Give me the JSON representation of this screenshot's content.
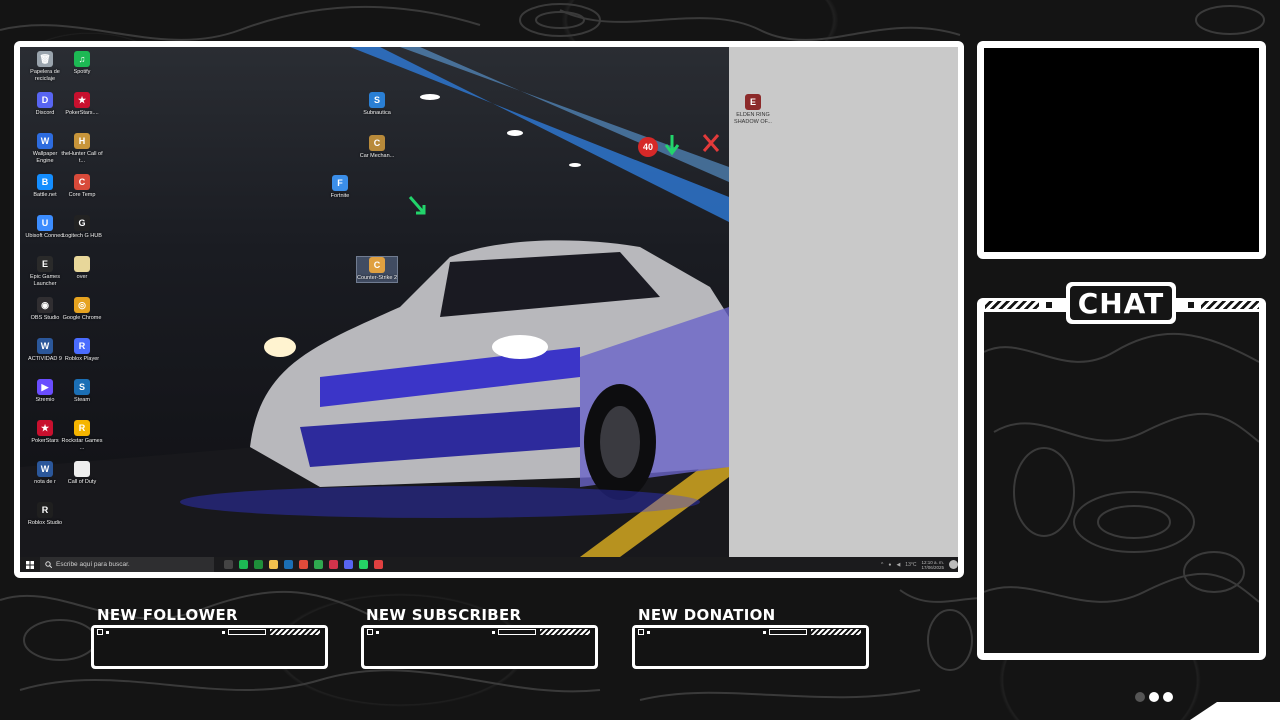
{
  "desktop": {
    "icons_left": [
      {
        "label": "Papelera de reciclaje",
        "color": "#9aa4ad",
        "glyph": "🗑"
      },
      {
        "label": "Spotify",
        "color": "#1db954",
        "glyph": "♫"
      },
      {
        "label": "Discord",
        "color": "#5865f2",
        "glyph": "D"
      },
      {
        "label": "PokerStars....",
        "color": "#c8102e",
        "glyph": "★"
      },
      {
        "label": "Wallpaper Engine",
        "color": "#2d6cdf",
        "glyph": "W"
      },
      {
        "label": "theHunter Call of t...",
        "color": "#c8953a",
        "glyph": "H"
      },
      {
        "label": "Battle.net",
        "color": "#148eff",
        "glyph": "B"
      },
      {
        "label": "Core Temp",
        "color": "#d84a3a",
        "glyph": "C"
      },
      {
        "label": "Ubisoft Connect",
        "color": "#3c8dff",
        "glyph": "U"
      },
      {
        "label": "Logitech G HUB",
        "color": "#222222",
        "glyph": "G"
      },
      {
        "label": "Epic Games Launcher",
        "color": "#2a2a2a",
        "glyph": "E"
      },
      {
        "label": "over",
        "color": "#e8d79a",
        "glyph": ""
      },
      {
        "label": "OBS Studio",
        "color": "#302e31",
        "glyph": "◉"
      },
      {
        "label": "Google Chrome",
        "color": "#e6a320",
        "glyph": "◎"
      },
      {
        "label": "ACTIVIDAD 9",
        "color": "#2b579a",
        "glyph": "W"
      },
      {
        "label": "Roblox Player",
        "color": "#4a6cff",
        "glyph": "R"
      },
      {
        "label": "Stremio",
        "color": "#6a4dff",
        "glyph": "▶"
      },
      {
        "label": "Steam",
        "color": "#1b6fb5",
        "glyph": "S"
      },
      {
        "label": "PokerStars",
        "color": "#c8102e",
        "glyph": "★"
      },
      {
        "label": "Rockstar Games ...",
        "color": "#f5b500",
        "glyph": "R"
      },
      {
        "label": "nota de r",
        "color": "#2b579a",
        "glyph": "W"
      },
      {
        "label": "Call of Duty",
        "color": "#eeeeee",
        "glyph": ""
      },
      {
        "label": "Roblox Studio",
        "color": "#1f1f1f",
        "glyph": "R"
      }
    ],
    "icons_middle": [
      {
        "label": "Subnautica",
        "color": "#2a7fd4",
        "glyph": "S"
      },
      {
        "label": "Car Mechan...",
        "color": "#b88a3a",
        "glyph": "C"
      },
      {
        "label": "Fortnite",
        "color": "#3b8ee8",
        "glyph": "F"
      },
      {
        "label": "Counter-Strike 2",
        "color": "#e0a040",
        "glyph": "C"
      }
    ],
    "icon_right_pane": {
      "label": "ELDEN RING SHADOW OF...",
      "color": "#8c2a2a",
      "glyph": "E"
    }
  },
  "taskbar": {
    "search_placeholder": "Escribe aquí para buscar.",
    "apps": [
      "#444444",
      "#1db954",
      "#1e8f3a",
      "#f2c14e",
      "#1b6fb5",
      "#e04b3a",
      "#2fa84f",
      "#d1334b",
      "#5865f2",
      "#25d366",
      "#e04040"
    ],
    "tray_temp": "13°C",
    "clock_time": "12:10 a. m.",
    "clock_date": "17/06/2025"
  },
  "overlay": {
    "chat_title": "CHAT",
    "alerts": [
      {
        "title": "NEW FOLLOWER"
      },
      {
        "title": "NEW SUBSCRIBER"
      },
      {
        "title": "NEW DONATION"
      }
    ]
  }
}
